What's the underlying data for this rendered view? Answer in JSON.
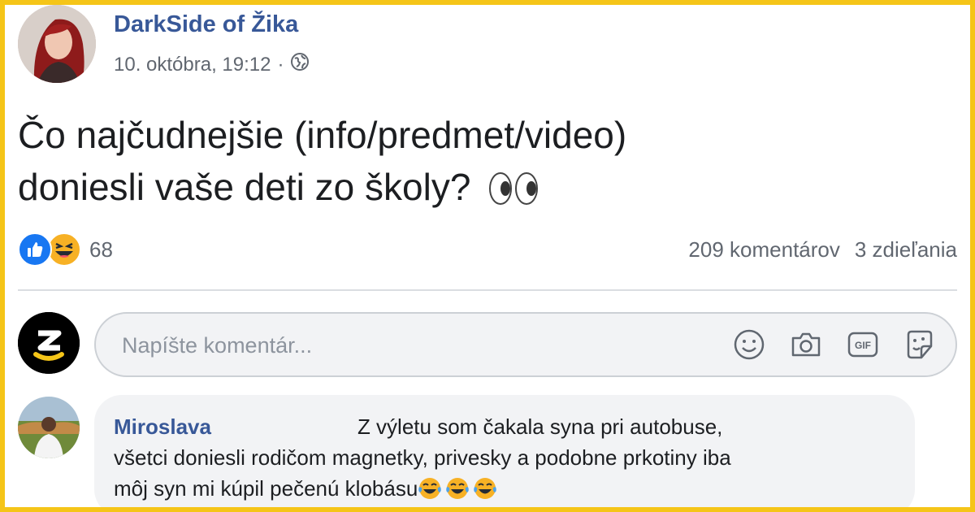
{
  "post": {
    "page_name": "DarkSide of Žika",
    "timestamp": "10. októbra, 19:12",
    "separator": "·",
    "privacy_icon": "globe-icon",
    "text_line1": "Čo najčudnejšie (info/predmet/video)",
    "text_line2": "doniesli vaše deti zo školy?",
    "text_emoji": "eyes-icon"
  },
  "reactions": {
    "types": [
      "like-icon",
      "haha-icon"
    ],
    "count": "68",
    "comments": "209 komentárov",
    "shares": "3 zdieľania"
  },
  "composer": {
    "placeholder": "Napíšte komentár...",
    "icons": [
      "smiley-icon",
      "camera-icon",
      "gif-icon",
      "sticker-icon"
    ]
  },
  "comments": [
    {
      "author": "Miroslava",
      "line1": "Z výletu som čakala syna pri autobuse,",
      "line2": "všetci doniesli rodičom magnetky, privesky a podobne prkotiny iba",
      "line3": "môj syn mi kúpil pečenú klobásu",
      "trailing_emojis": [
        "crying-laughing-icon",
        "crying-laughing-icon",
        "crying-laughing-icon"
      ]
    }
  ],
  "colors": {
    "frame": "#f5c518",
    "link": "#385898",
    "secondary_text": "#616770",
    "bubble": "#f2f3f5",
    "like_blue": "#1877f2",
    "haha_yellow": "#f7b125"
  }
}
